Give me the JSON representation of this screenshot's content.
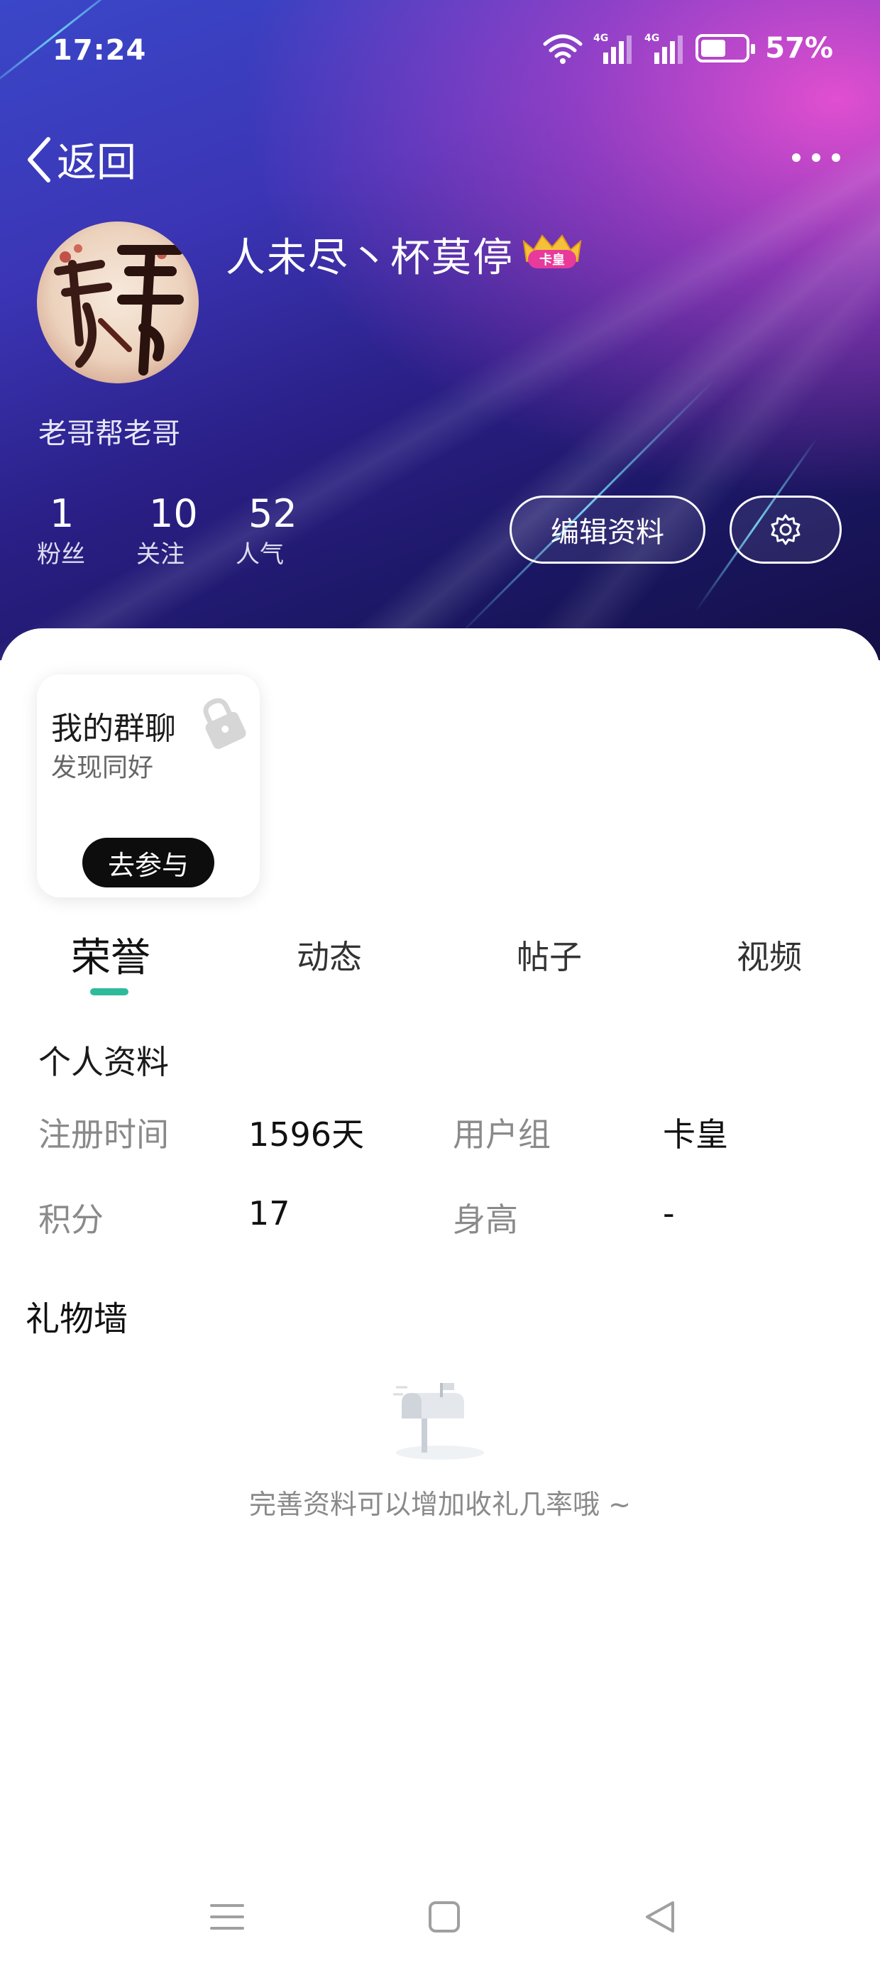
{
  "status_bar": {
    "time": "17:24",
    "network_1": "4G",
    "network_2": "4G",
    "battery_percent": "57%",
    "battery_level": 0.57
  },
  "nav": {
    "back_label": "返回",
    "back_icon": "chevron-left-icon",
    "more_icon": "more-dots-icon"
  },
  "profile": {
    "username": "人未尽丶杯莫停",
    "badge_text": "卡皇",
    "bio": "老哥帮老哥",
    "stats": [
      {
        "value": "1",
        "label": "粉丝"
      },
      {
        "value": "10",
        "label": "关注"
      },
      {
        "value": "52",
        "label": "人气"
      }
    ],
    "edit_button": "编辑资料",
    "settings_icon": "gear-icon"
  },
  "group_card": {
    "title": "我的群聊",
    "subtitle": "发现同好",
    "button": "去参与",
    "icon": "lock-icon"
  },
  "tabs": [
    "荣誉",
    "动态",
    "帖子",
    "视频"
  ],
  "active_tab": 0,
  "personal_info": {
    "title": "个人资料",
    "rows": [
      {
        "label1": "注册时间",
        "value1": "1596天",
        "label2": "用户组",
        "value2": "卡皇"
      },
      {
        "label1": "积分",
        "value1": "17",
        "label2": "身高",
        "value2": "-"
      }
    ]
  },
  "gift_wall": {
    "title": "礼物墙",
    "empty_text": "完善资料可以增加收礼几率哦 ~",
    "empty_icon": "mailbox-icon"
  },
  "system_nav": [
    "menu-icon",
    "home-square-icon",
    "back-triangle-icon"
  ],
  "colors": {
    "accent": "#2dbb9a",
    "header_start": "#3a47c8",
    "header_end": "#140f46",
    "header_glow": "#e04fd0"
  }
}
